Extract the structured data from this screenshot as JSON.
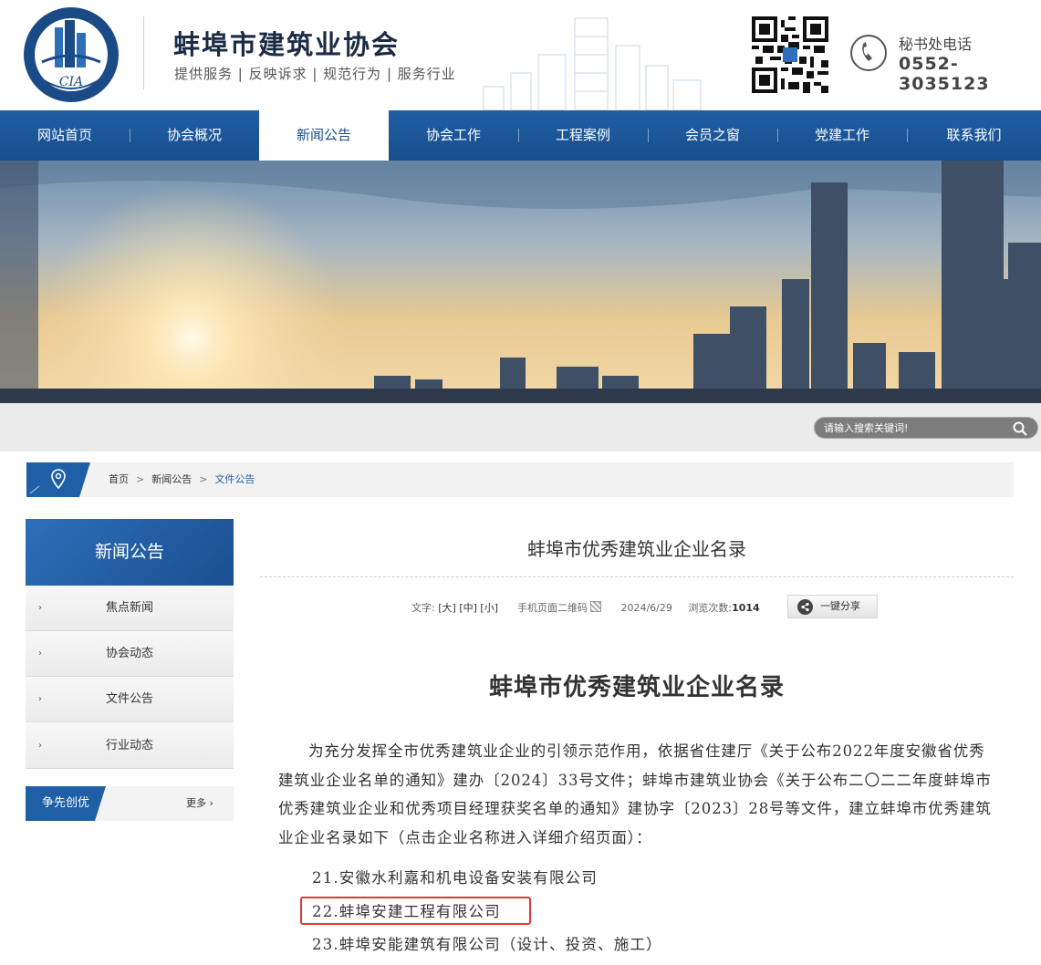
{
  "header": {
    "logo_text_top": "蚌埠市建筑业协会",
    "logo_abbr": "CIA",
    "title": "蚌埠市建筑业协会",
    "slogan": "提供服务 | 反映诉求 | 规范行为 | 服务行业",
    "phone_label": "秘书处电话",
    "phone_number": "0552-3035123"
  },
  "nav": {
    "items": [
      {
        "label": "网站首页",
        "active": false
      },
      {
        "label": "协会概况",
        "active": false
      },
      {
        "label": "新闻公告",
        "active": true
      },
      {
        "label": "协会工作",
        "active": false
      },
      {
        "label": "工程案例",
        "active": false
      },
      {
        "label": "会员之窗",
        "active": false
      },
      {
        "label": "党建工作",
        "active": false
      },
      {
        "label": "联系我们",
        "active": false
      }
    ]
  },
  "search": {
    "placeholder": "请输入搜索关键词!"
  },
  "breadcrumb": {
    "home": "首页",
    "section": "新闻公告",
    "current": "文件公告"
  },
  "sidebar": {
    "title": "新闻公告",
    "items": [
      {
        "label": "焦点新闻"
      },
      {
        "label": "协会动态"
      },
      {
        "label": "文件公告"
      },
      {
        "label": "行业动态"
      }
    ],
    "sub_title": "争先创优",
    "more": "更多 ›"
  },
  "article": {
    "title": "蚌埠市优秀建筑业企业名录",
    "font_label": "文字:",
    "size_large": "[大]",
    "size_medium": "[中]",
    "size_small": "[小]",
    "qr_label": "手机页面二维码",
    "date": "2024/6/29",
    "views_label": "浏览次数:",
    "views": "1014",
    "share": "一键分享",
    "doc_title": "蚌埠市优秀建筑业企业名录",
    "body": "为充分发挥全市优秀建筑业企业的引领示范作用，依据省住建厅《关于公布2022年度安徽省优秀建筑业企业名单的通知》建办〔2024〕33号文件；蚌埠市建筑业协会《关于公布二〇二二年度蚌埠市优秀建筑业企业和优秀项目经理获奖名单的通知》建协字〔2023〕28号等文件，建立蚌埠市优秀建筑业企业名录如下（点击企业名称进入详细介绍页面）：",
    "list": [
      "21.安徽水利嘉和机电设备安装有限公司",
      "22.蚌埠安建工程有限公司",
      "23.蚌埠安能建筑有限公司（设计、投资、施工）"
    ]
  },
  "colors": {
    "nav_blue": "#1f5fa5",
    "highlight_red": "#e23a3a"
  }
}
